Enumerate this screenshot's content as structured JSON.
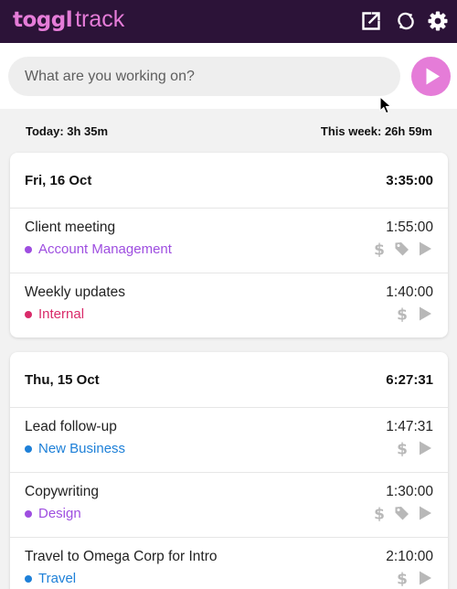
{
  "app": {
    "logo_primary": "toggl",
    "logo_secondary": "track",
    "brand_color": "#e57cd8",
    "header_bg": "#2c1338"
  },
  "toolbar": {
    "icons": [
      "open-in-new-window-icon",
      "sync-icon",
      "settings-gear-icon"
    ]
  },
  "timer": {
    "placeholder": "What are you working on?",
    "value": ""
  },
  "summary": {
    "today": "Today: 3h 35m",
    "week": "This week: 26h 59m"
  },
  "days": [
    {
      "date": "Fri, 16 Oct",
      "total": "3:35:00",
      "entries": [
        {
          "description": "Client meeting",
          "duration": "1:55:00",
          "project": "Account Management",
          "project_color": "#9e4ee0",
          "billable": true,
          "tagged": true
        },
        {
          "description": "Weekly updates",
          "duration": "1:40:00",
          "project": "Internal",
          "project_color": "#d92b6a",
          "billable": true,
          "tagged": false
        }
      ]
    },
    {
      "date": "Thu, 15 Oct",
      "total": "6:27:31",
      "entries": [
        {
          "description": "Lead follow-up",
          "duration": "1:47:31",
          "project": "New Business",
          "project_color": "#1e80d8",
          "billable": true,
          "tagged": false
        },
        {
          "description": "Copywriting",
          "duration": "1:30:00",
          "project": "Design",
          "project_color": "#9e4ee0",
          "billable": true,
          "tagged": true
        },
        {
          "description": "Travel to Omega Corp for Intro",
          "duration": "2:10:00",
          "project": "Travel",
          "project_color": "#1e80d8",
          "billable": true,
          "tagged": false
        }
      ]
    }
  ]
}
